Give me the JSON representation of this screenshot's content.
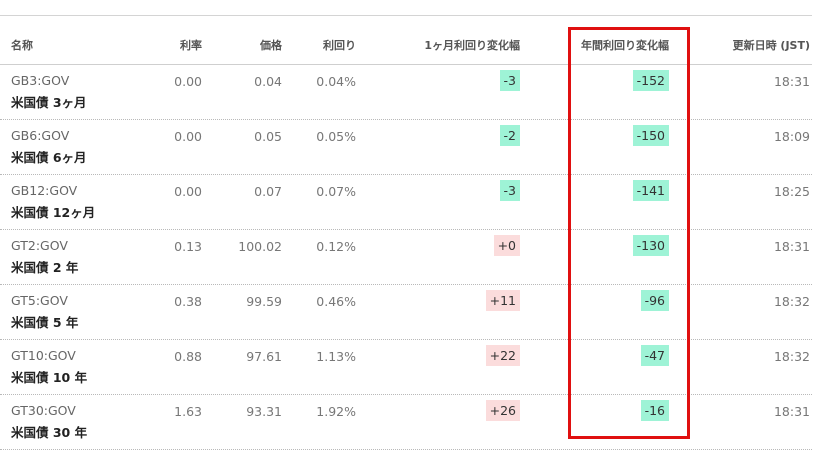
{
  "headers": {
    "name": "名称",
    "rate": "利率",
    "price": "価格",
    "yield": "利回り",
    "change_1m": "1ヶ月利回り変化幅",
    "change_1y": "年間利回り変化幅",
    "updated": "更新日時 (JST)"
  },
  "rows": [
    {
      "code": "GB3:GOV",
      "name": "米国債 3ヶ月",
      "rate": "0.00",
      "price": "0.04",
      "yield": "0.04%",
      "change_1m": "-3",
      "change_1y": "-152",
      "updated": "18:31"
    },
    {
      "code": "GB6:GOV",
      "name": "米国債 6ヶ月",
      "rate": "0.00",
      "price": "0.05",
      "yield": "0.05%",
      "change_1m": "-2",
      "change_1y": "-150",
      "updated": "18:09"
    },
    {
      "code": "GB12:GOV",
      "name": "米国債 12ヶ月",
      "rate": "0.00",
      "price": "0.07",
      "yield": "0.07%",
      "change_1m": "-3",
      "change_1y": "-141",
      "updated": "18:25"
    },
    {
      "code": "GT2:GOV",
      "name": "米国債 2 年",
      "rate": "0.13",
      "price": "100.02",
      "yield": "0.12%",
      "change_1m": "+0",
      "change_1y": "-130",
      "updated": "18:31"
    },
    {
      "code": "GT5:GOV",
      "name": "米国債 5 年",
      "rate": "0.38",
      "price": "99.59",
      "yield": "0.46%",
      "change_1m": "+11",
      "change_1y": "-96",
      "updated": "18:32"
    },
    {
      "code": "GT10:GOV",
      "name": "米国債 10 年",
      "rate": "0.88",
      "price": "97.61",
      "yield": "1.13%",
      "change_1m": "+22",
      "change_1y": "-47",
      "updated": "18:32"
    },
    {
      "code": "GT30:GOV",
      "name": "米国債 30 年",
      "rate": "1.63",
      "price": "93.31",
      "yield": "1.92%",
      "change_1m": "+26",
      "change_1y": "-16",
      "updated": "18:31"
    }
  ],
  "colors": {
    "negative_badge": "#9ef3d6",
    "positive_badge": "#fbdcdc",
    "highlight_border": "#e01010"
  }
}
